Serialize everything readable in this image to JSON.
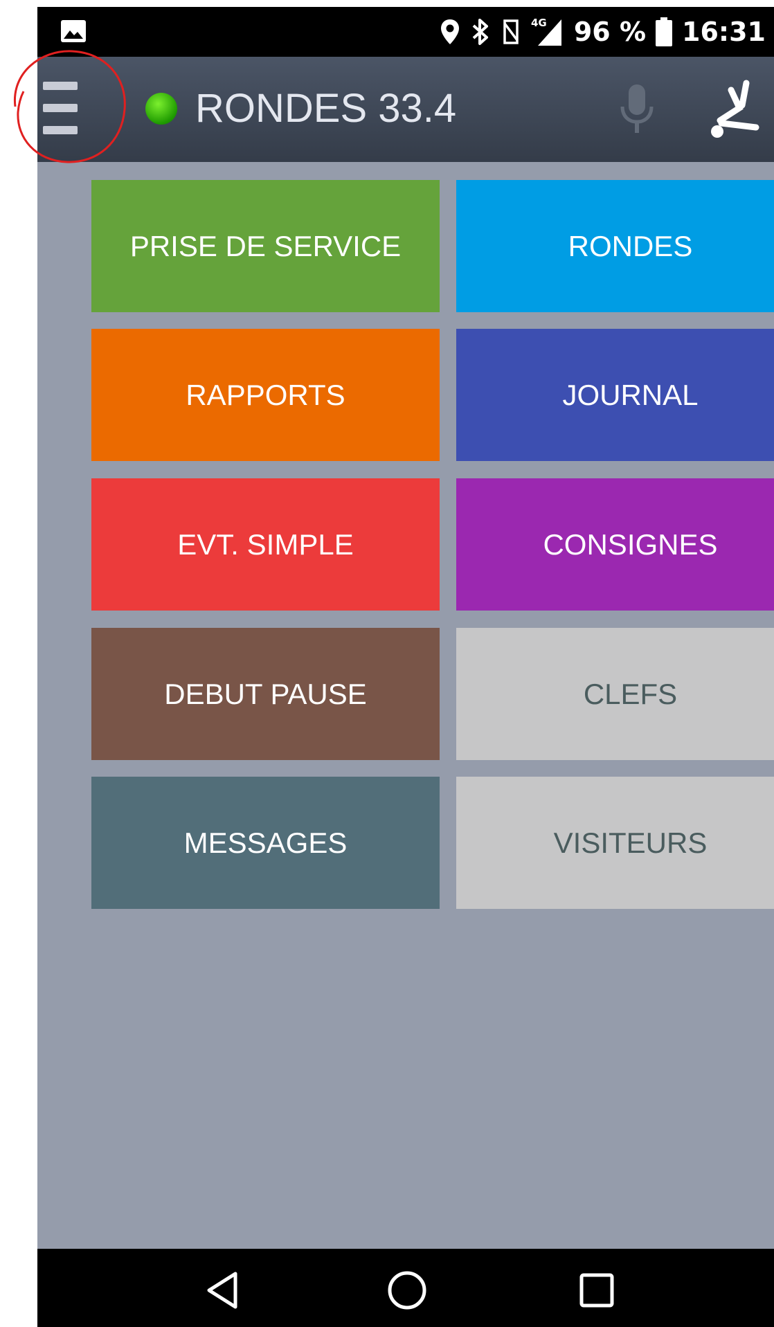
{
  "status_bar": {
    "network": "4G",
    "battery": "96 %",
    "time": "16:31",
    "icons": [
      "gallery-icon",
      "location-icon",
      "bluetooth-icon",
      "nfc-icon",
      "signal-icon",
      "battery-icon"
    ]
  },
  "app_bar": {
    "title": "RONDES 33.4",
    "status_color": "#2fbf00",
    "icons": [
      "menu-icon",
      "microphone-icon",
      "man-down-icon"
    ]
  },
  "tiles": [
    {
      "label": "PRISE DE SERVICE",
      "color": "#65a33b",
      "text_color": "#ffffff"
    },
    {
      "label": "RONDES",
      "color": "#009de4",
      "text_color": "#ffffff"
    },
    {
      "label": "RAPPORTS",
      "color": "#eb6a00",
      "text_color": "#ffffff"
    },
    {
      "label": "JOURNAL",
      "color": "#3d4fb1",
      "text_color": "#ffffff"
    },
    {
      "label": "EVT. SIMPLE",
      "color": "#ec3b3b",
      "text_color": "#ffffff"
    },
    {
      "label": "CONSIGNES",
      "color": "#9b28b0",
      "text_color": "#ffffff"
    },
    {
      "label": "DEBUT PAUSE",
      "color": "#795548",
      "text_color": "#ffffff"
    },
    {
      "label": "CLEFS",
      "color": "#c6c6c7",
      "text_color": "#4a5c5e"
    },
    {
      "label": "MESSAGES",
      "color": "#526e79",
      "text_color": "#ffffff"
    },
    {
      "label": "VISITEURS",
      "color": "#c6c6c7",
      "text_color": "#4a5c5e"
    }
  ],
  "nav_bar": {
    "icons": [
      "back-icon",
      "home-icon",
      "recents-icon"
    ]
  },
  "colors": {
    "background": "#959cab",
    "app_bar": "#3d4553",
    "annotation": "#e02020"
  }
}
